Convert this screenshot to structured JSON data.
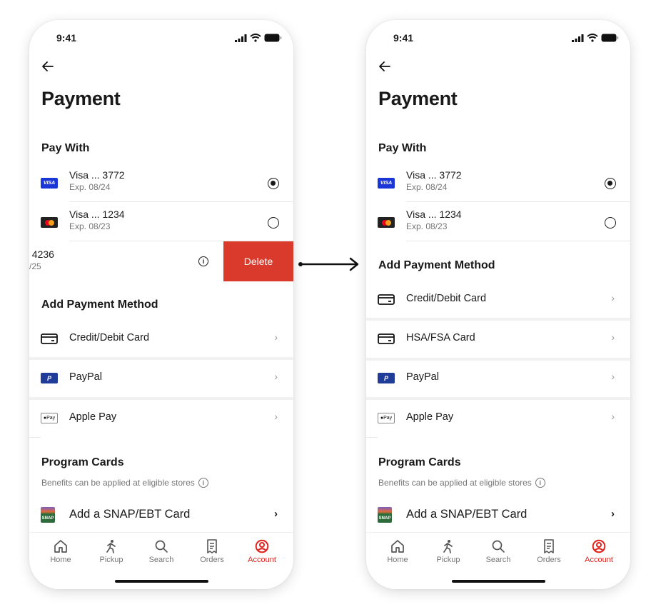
{
  "status_bar": {
    "time": "9:41"
  },
  "left": {
    "title": "Payment",
    "pay_with_heading": "Pay With",
    "cards": [
      {
        "brand": "visa",
        "name": "Visa ... 3772",
        "exp": "Exp. 08/24",
        "selected": true
      },
      {
        "brand": "mastercard",
        "name": "Visa ... 1234",
        "exp": "Exp. 08/23",
        "selected": false
      }
    ],
    "swiped_card": {
      "name": ". 4236",
      "exp": ")/25",
      "delete_label": "Delete"
    },
    "add_heading": "Add Payment Method",
    "methods": [
      {
        "icon": "credit-card-icon",
        "label": "Credit/Debit Card"
      },
      {
        "icon": "paypal-icon",
        "label": "PayPal"
      },
      {
        "icon": "apple-pay-icon",
        "label": "Apple Pay"
      }
    ],
    "program_heading": "Program Cards",
    "program_sub": "Benefits can be applied at eligible stores",
    "snap_label": "Add a SNAP/EBT Card"
  },
  "right": {
    "title": "Payment",
    "pay_with_heading": "Pay With",
    "cards": [
      {
        "brand": "visa",
        "name": "Visa ... 3772",
        "exp": "Exp. 08/24",
        "selected": true
      },
      {
        "brand": "mastercard",
        "name": "Visa ... 1234",
        "exp": "Exp. 08/23",
        "selected": false
      }
    ],
    "add_heading": "Add Payment Method",
    "methods": [
      {
        "icon": "credit-card-icon",
        "label": "Credit/Debit Card"
      },
      {
        "icon": "credit-card-icon",
        "label": "HSA/FSA Card"
      },
      {
        "icon": "paypal-icon",
        "label": "PayPal"
      },
      {
        "icon": "apple-pay-icon",
        "label": "Apple Pay"
      }
    ],
    "program_heading": "Program Cards",
    "program_sub": "Benefits can be applied at eligible stores",
    "snap_label": "Add a SNAP/EBT Card"
  },
  "icons": {
    "visa_text": "VISA",
    "apple_pay_text": "Pay",
    "info": "i",
    "chevron": "›",
    "snap_text": "SNAP"
  },
  "tabs": [
    {
      "icon": "home-icon",
      "label": "Home",
      "active": false
    },
    {
      "icon": "pickup-icon",
      "label": "Pickup",
      "active": false
    },
    {
      "icon": "search-icon",
      "label": "Search",
      "active": false
    },
    {
      "icon": "orders-icon",
      "label": "Orders",
      "active": false
    },
    {
      "icon": "account-icon",
      "label": "Account",
      "active": true
    }
  ],
  "colors": {
    "accent": "#e0221c",
    "delete": "#d93a2b",
    "visa": "#1a36d6",
    "paypal": "#1f3c99"
  }
}
